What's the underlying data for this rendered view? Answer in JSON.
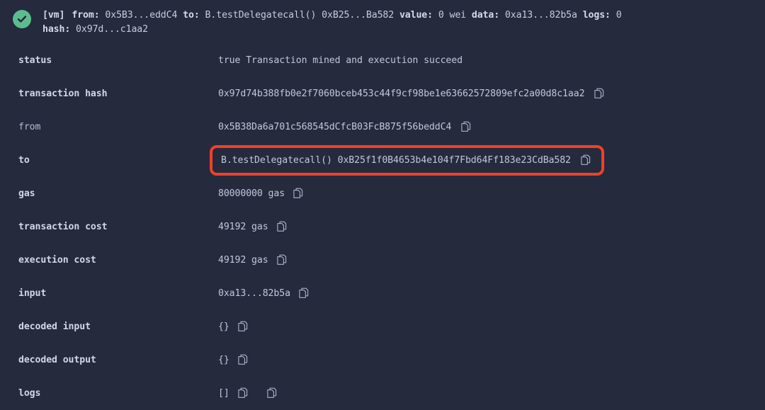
{
  "summary": {
    "status_icon": "check-circle-icon",
    "status_color": "#5bbd8e",
    "accent_highlight_color": "#f0402a",
    "background_color": "#252a3d",
    "vm_tag": "[vm]",
    "from_label": "from:",
    "from_value": "0x5B3...eddC4",
    "to_label": "to:",
    "to_value": "B.testDelegatecall() 0xB25...Ba582",
    "value_label": "value:",
    "value_value": "0 wei",
    "data_label": "data:",
    "data_value": "0xa13...82b5a",
    "logs_label": "logs:",
    "logs_value": "0",
    "hash_label": "hash:",
    "hash_value": "0x97d...c1aa2"
  },
  "details": {
    "rows": [
      {
        "label": "status",
        "value": "true Transaction mined and execution succeed",
        "label_weight": "bold",
        "copies": 0,
        "highlighted": false
      },
      {
        "label": "transaction hash",
        "value": "0x97d74b388fb0e2f7060bceb453c44f9cf98be1e63662572809efc2a00d8c1aa2",
        "label_weight": "bold",
        "copies": 1,
        "highlighted": false
      },
      {
        "label": "from",
        "value": "0x5B38Da6a701c568545dCfcB03FcB875f56beddC4",
        "label_weight": "regular",
        "copies": 1,
        "highlighted": false
      },
      {
        "label": "to",
        "value": "B.testDelegatecall() 0xB25f1f0B4653b4e104f7Fbd64Ff183e23CdBa582",
        "label_weight": "bold",
        "copies": 1,
        "highlighted": true
      },
      {
        "label": "gas",
        "value": "80000000 gas",
        "label_weight": "bold",
        "copies": 1,
        "highlighted": false
      },
      {
        "label": "transaction cost",
        "value": "49192 gas",
        "label_weight": "bold",
        "copies": 1,
        "highlighted": false
      },
      {
        "label": "execution cost",
        "value": "49192 gas",
        "label_weight": "bold",
        "copies": 1,
        "highlighted": false
      },
      {
        "label": "input",
        "value": "0xa13...82b5a",
        "label_weight": "bold",
        "copies": 1,
        "highlighted": false
      },
      {
        "label": "decoded input",
        "value": "{}",
        "label_weight": "bold",
        "copies": 1,
        "highlighted": false
      },
      {
        "label": "decoded output",
        "value": "{}",
        "label_weight": "bold",
        "copies": 1,
        "highlighted": false
      },
      {
        "label": "logs",
        "value": "[]",
        "label_weight": "bold",
        "copies": 2,
        "highlighted": false
      }
    ]
  }
}
